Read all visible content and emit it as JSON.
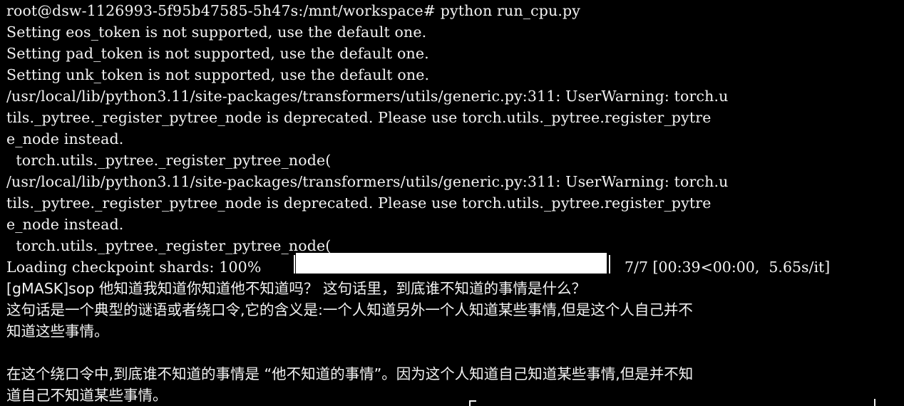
{
  "terminal": {
    "lines": [
      "root@dsw-1126993-5f95b47585-5h47s:/mnt/workspace# python run_cpu.py",
      "Setting eos_token is not supported, use the default one.",
      "Setting pad_token is not supported, use the default one.",
      "Setting unk_token is not supported, use the default one.",
      "/usr/local/lib/python3.11/site-packages/transformers/utils/generic.py:311: UserWarning: torch.u",
      "tils._pytree._register_pytree_node is deprecated. Please use torch.utils._pytree.register_pytre",
      "e_node instead.",
      "  torch.utils._pytree._register_pytree_node(",
      "/usr/local/lib/python3.11/site-packages/transformers/utils/generic.py:311: UserWarning: torch.u",
      "tils._pytree._register_pytree_node is deprecated. Please use torch.utils._pytree.register_pytre",
      "e_node instead.",
      "  torch.utils._pytree._register_pytree_node("
    ],
    "progress": {
      "prefix": "Loading checkpoint shards: 100%",
      "fraction": 1.0,
      "suffix": "7/7 [00:39<00:00,  5.65s/it]"
    },
    "output_lines": [
      "[gMASK]sop 他知道我知道你知道他不知道吗？ 这句话里，到底谁不知道的事情是什么？",
      "这句话是一个典型的谜语或者绕口令,它的含义是:一个人知道另外一个人知道某些事情,但是这个人自己并不",
      "知道这些事情。",
      "在这个绕口令中,到底谁不知道的事情是 “他不知道的事情”。因为这个人知道自己知道某些事情,但是并不知",
      "道自己不知道某些事情。"
    ]
  }
}
